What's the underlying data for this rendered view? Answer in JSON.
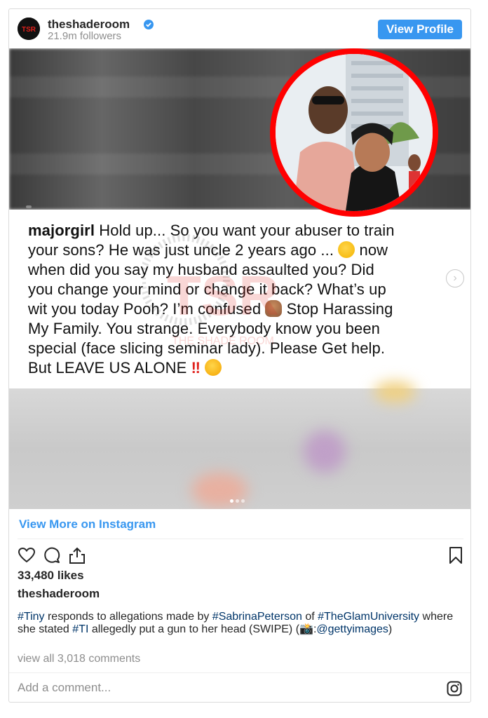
{
  "header": {
    "username": "theshaderoom",
    "followers": "21.9m followers",
    "view_profile_label": "View Profile",
    "avatar_text": "TSR"
  },
  "media": {
    "post_username": "majorgirl",
    "post_lines": [
      "Hold up... So you want your abuser to train",
      "your sons? He was just uncle 2 years ago ...",
      "now",
      "when did you say my husband assaulted you? Did",
      "you change your mind or change it back? What’s up",
      "wit you today Pooh? I’m confused",
      "Stop Harassing",
      "My Family. You strange. Everybody know you been",
      "special (face slicing seminar lady). Please Get help.",
      "But LEAVE US ALONE"
    ],
    "bang_emoji": "‼",
    "watermark_text": "TSR",
    "watermark_sub": "THE SHADE ROOM",
    "next_arrow": "›",
    "carousel_dots": 3,
    "carousel_active": 0
  },
  "view_more_label": "View More on Instagram",
  "likes": "33,480 likes",
  "poster": "theshaderoom",
  "caption": {
    "parts": [
      {
        "t": "#Tiny",
        "tag": true
      },
      {
        "t": " responds to allegations made by ",
        "tag": false
      },
      {
        "t": "#SabrinaPeterson",
        "tag": true
      },
      {
        "t": " of ",
        "tag": false
      },
      {
        "t": "#TheGlamUniversity",
        "tag": true
      },
      {
        "t": " where she stated ",
        "tag": false
      },
      {
        "t": "#TI",
        "tag": true
      },
      {
        "t": " allegedly put a gun to her head (SWIPE) (📸:",
        "tag": false
      },
      {
        "t": "@gettyimages",
        "tag": true
      },
      {
        "t": ")",
        "tag": false
      }
    ]
  },
  "comments_label": "view all 3,018 comments",
  "comment_placeholder": "Add a comment...",
  "icons": [
    "heart-icon",
    "comment-icon",
    "share-icon",
    "bookmark-icon",
    "instagram-icon",
    "verified-icon"
  ],
  "colors": {
    "accent": "#3897f0",
    "tag": "#003569",
    "circle": "#ff0000"
  }
}
